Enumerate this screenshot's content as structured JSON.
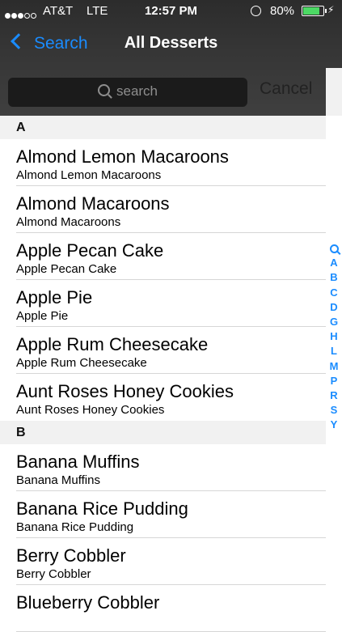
{
  "status_bar": {
    "carrier": "AT&T",
    "network": "LTE",
    "time": "12:57 PM",
    "battery_percent": "80%",
    "battery_level": 0.8,
    "battery_color": "#4cd964",
    "signal_bars_filled": 3
  },
  "nav": {
    "back_label": "Search",
    "title": "All Desserts",
    "accent_color": "#1a8cff"
  },
  "search": {
    "placeholder": "search",
    "cancel_label": "Cancel"
  },
  "sections": [
    {
      "header": "A",
      "items": [
        {
          "title": "Almond Lemon Macaroons",
          "subtitle": "Almond Lemon Macaroons"
        },
        {
          "title": "Almond Macaroons",
          "subtitle": "Almond Macaroons"
        },
        {
          "title": "Apple Pecan Cake",
          "subtitle": "Apple Pecan Cake"
        },
        {
          "title": "Apple Pie",
          "subtitle": "Apple Pie"
        },
        {
          "title": "Apple Rum Cheesecake",
          "subtitle": "Apple Rum Cheesecake"
        },
        {
          "title": "Aunt Roses Honey Cookies",
          "subtitle": "Aunt Roses Honey Cookies"
        }
      ]
    },
    {
      "header": "B",
      "items": [
        {
          "title": "Banana Muffins",
          "subtitle": "Banana Muffins"
        },
        {
          "title": "Banana Rice Pudding",
          "subtitle": "Banana Rice Pudding"
        },
        {
          "title": "Berry Cobbler",
          "subtitle": "Berry Cobbler"
        },
        {
          "title": "Blueberry Cobbler",
          "subtitle": ""
        }
      ]
    }
  ],
  "index": {
    "search_icon": "search-icon",
    "letters": [
      "A",
      "B",
      "C",
      "D",
      "G",
      "H",
      "L",
      "M",
      "P",
      "R",
      "S",
      "Y"
    ]
  }
}
